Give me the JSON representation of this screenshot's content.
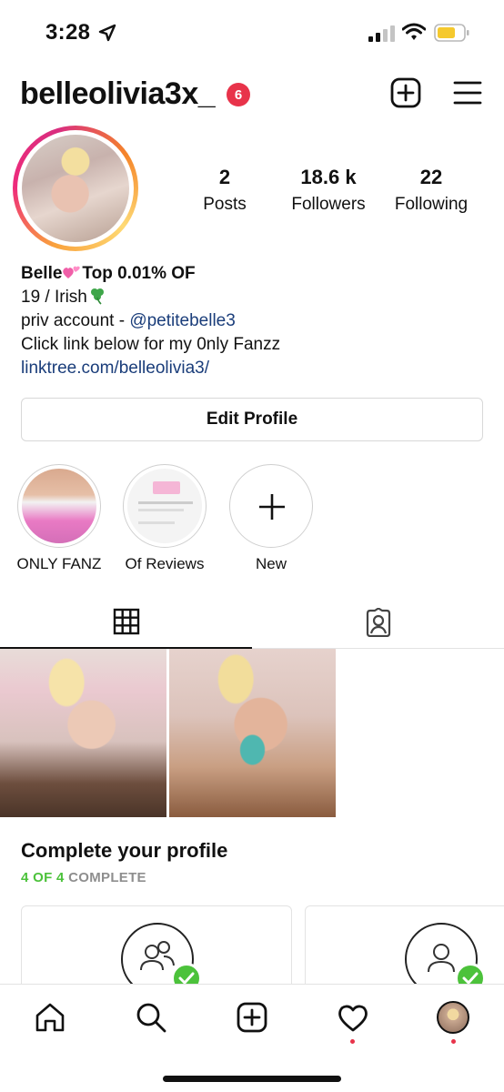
{
  "status_bar": {
    "time": "3:28",
    "battery_color": "#f5c92e"
  },
  "header": {
    "username": "belleolivia3x_",
    "notification_count": "6",
    "badge_color": "#e8334a"
  },
  "stats": {
    "posts_value": "2",
    "posts_label": "Posts",
    "followers_value": "18.6 k",
    "followers_label": "Followers",
    "following_value": "22",
    "following_label": "Following"
  },
  "bio": {
    "name": "Belle",
    "name_suffix": "Top 0.01% OF",
    "line2": "19 / Irish",
    "line3_prefix": "priv account - ",
    "line3_mention": "@petitebelle3",
    "line4": "Click link below for my 0nly Fanzz",
    "link": "linktree.com/belleolivia3/"
  },
  "edit_profile_label": "Edit Profile",
  "highlights": [
    {
      "label": "ONLY FANZ"
    },
    {
      "label": "Of Reviews"
    },
    {
      "label": "New"
    }
  ],
  "tabs": [
    {
      "icon": "grid-icon",
      "active": true
    },
    {
      "icon": "tagged-icon",
      "active": false
    }
  ],
  "posts": [
    {
      "icon": "photo"
    },
    {
      "icon": "photo"
    }
  ],
  "complete_profile": {
    "title": "Complete your profile",
    "progress_done": "4 OF 4",
    "progress_label": "COMPLETE",
    "accent_color": "#4cc23b",
    "cards": [
      {
        "icon": "people-icon"
      },
      {
        "icon": "person-icon"
      }
    ]
  },
  "bottom_nav": [
    {
      "icon": "home-icon"
    },
    {
      "icon": "search-icon"
    },
    {
      "icon": "add-post-icon"
    },
    {
      "icon": "activity-heart-icon"
    },
    {
      "icon": "profile-avatar-icon"
    }
  ]
}
